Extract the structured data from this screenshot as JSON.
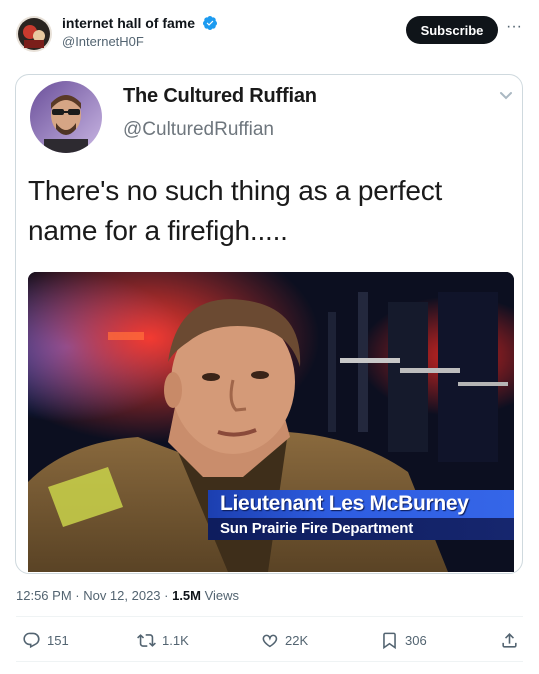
{
  "post": {
    "author_name": "internet hall of fame",
    "author_handle": "@InternetH0F",
    "subscribe_label": "Subscribe",
    "more_label": "···"
  },
  "quoted_screenshot": {
    "name": "The Cultured Ruffian",
    "handle": "@CulturedRuffian",
    "text": "There's no such thing as a perfect name for a firefigh....."
  },
  "news_image": {
    "lower_third_name": "Lieutenant Les McBurney",
    "lower_third_title": "Sun Prairie Fire Department"
  },
  "meta": {
    "time_date": "12:56 PM · Nov 12, 2023 · ",
    "views_count": "1.5M",
    "views_label": " Views"
  },
  "actions": {
    "replies": "151",
    "reposts": "1.1K",
    "likes": "22K",
    "bookmarks": "306"
  },
  "colors": {
    "verified": "#1d9bf0",
    "text_primary": "#0f1419",
    "text_secondary": "#536471",
    "subscribe_bg": "#0f1419",
    "lower_third_blue": "#2e5de0"
  }
}
